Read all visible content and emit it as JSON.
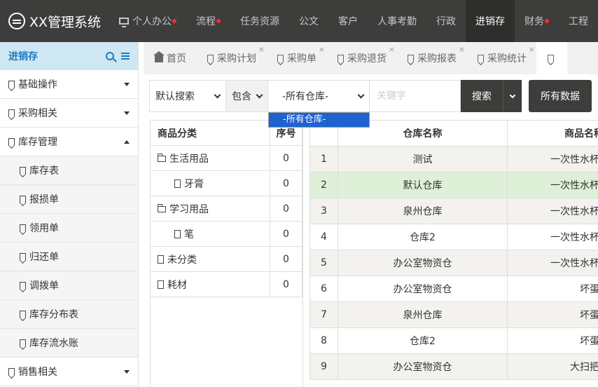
{
  "app": {
    "title": "XX管理系统"
  },
  "topnav": [
    {
      "label": "个人办公",
      "dot": true,
      "icon": "monitor-icon"
    },
    {
      "label": "流程",
      "dot": true
    },
    {
      "label": "任务资源",
      "dot": false
    },
    {
      "label": "公文",
      "dot": false
    },
    {
      "label": "客户",
      "dot": false
    },
    {
      "label": "人事考勤",
      "dot": false
    },
    {
      "label": "行政",
      "dot": false
    },
    {
      "label": "进销存",
      "dot": false,
      "active": true
    },
    {
      "label": "财务",
      "dot": true
    },
    {
      "label": "工程",
      "dot": false
    }
  ],
  "sidebar": {
    "title": "进销存",
    "items": [
      {
        "label": "基础操作",
        "type": "group",
        "caret": "down"
      },
      {
        "label": "采购相关",
        "type": "group",
        "caret": "down"
      },
      {
        "label": "库存管理",
        "type": "group",
        "caret": "up"
      },
      {
        "label": "库存表",
        "type": "sub"
      },
      {
        "label": "报损单",
        "type": "sub"
      },
      {
        "label": "领用单",
        "type": "sub"
      },
      {
        "label": "归还单",
        "type": "sub"
      },
      {
        "label": "调拨单",
        "type": "sub"
      },
      {
        "label": "库存分布表",
        "type": "sub"
      },
      {
        "label": "库存流水账",
        "type": "sub"
      },
      {
        "label": "销售相关",
        "type": "group",
        "caret": "down"
      }
    ]
  },
  "tabs": [
    {
      "label": "首页",
      "home": true
    },
    {
      "label": "采购计划",
      "close": "×"
    },
    {
      "label": "采购单",
      "close": "×"
    },
    {
      "label": "采购退货",
      "close": "×"
    },
    {
      "label": "采购报表",
      "close": "×"
    },
    {
      "label": "采购统计",
      "close": "×"
    },
    {
      "label": "",
      "active": true
    }
  ],
  "search": {
    "mode": "默认搜索",
    "match": "包含",
    "warehouse": "-所有仓库-",
    "keyword_placeholder": "关键字",
    "search_label": "搜索",
    "all_data_label": "所有数据",
    "dropdown_option": "-所有仓库-"
  },
  "category_table": {
    "headers": [
      "商品分类",
      "序号"
    ],
    "rows": [
      {
        "name": "生活用品",
        "num": "0",
        "icon": "folder-icon",
        "indent": false
      },
      {
        "name": "牙膏",
        "num": "0",
        "icon": "file-icon",
        "indent": true
      },
      {
        "name": "学习用品",
        "num": "0",
        "icon": "folder-icon",
        "indent": false
      },
      {
        "name": "笔",
        "num": "0",
        "icon": "file-icon",
        "indent": true
      },
      {
        "name": "未分类",
        "num": "0",
        "icon": "file-icon",
        "indent": false
      },
      {
        "name": "耗材",
        "num": "0",
        "icon": "file-icon",
        "indent": false
      }
    ]
  },
  "data_table": {
    "headers": [
      "",
      "仓库名称",
      "商品名称"
    ],
    "rows": [
      {
        "idx": "1",
        "warehouse": "测试",
        "product": "一次性水杯"
      },
      {
        "idx": "2",
        "warehouse": "默认仓库",
        "product": "一次性水杯",
        "highlight": true
      },
      {
        "idx": "3",
        "warehouse": "泉州仓库",
        "product": "一次性水杯"
      },
      {
        "idx": "4",
        "warehouse": "仓库2",
        "product": "一次性水杯"
      },
      {
        "idx": "5",
        "warehouse": "办公室物资仓",
        "product": "一次性水杯"
      },
      {
        "idx": "6",
        "warehouse": "办公室物资仓",
        "product": "坏蛋"
      },
      {
        "idx": "7",
        "warehouse": "泉州仓库",
        "product": "坏蛋"
      },
      {
        "idx": "8",
        "warehouse": "仓库2",
        "product": "坏蛋"
      },
      {
        "idx": "9",
        "warehouse": "办公室物资仓",
        "product": "大扫把"
      }
    ]
  }
}
